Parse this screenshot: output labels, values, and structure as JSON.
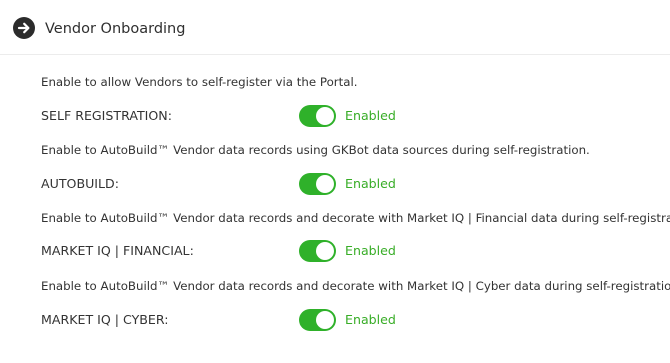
{
  "header": {
    "title": "Vendor Onboarding",
    "icon": "arrow-right-circle-icon"
  },
  "colors": {
    "toggle_on": "#2fb12a",
    "status_text": "#38ad27",
    "header_icon": "#2b2b2b"
  },
  "settings": [
    {
      "description": "Enable to allow Vendors to self-register via the Portal.",
      "label": "SELF REGISTRATION:",
      "enabled": true,
      "status": "Enabled"
    },
    {
      "description": "Enable to AutoBuild™ Vendor data records using GKBot data sources during self-registration.",
      "label": "AUTOBUILD:",
      "enabled": true,
      "status": "Enabled"
    },
    {
      "description": "Enable to AutoBuild™ Vendor data records and decorate with Market IQ | Financial data during self-registration.",
      "label": "MARKET IQ | FINANCIAL:",
      "enabled": true,
      "status": "Enabled"
    },
    {
      "description": "Enable to AutoBuild™ Vendor data records and decorate with Market IQ | Cyber data during self-registration.",
      "label": "MARKET IQ | CYBER:",
      "enabled": true,
      "status": "Enabled"
    }
  ]
}
